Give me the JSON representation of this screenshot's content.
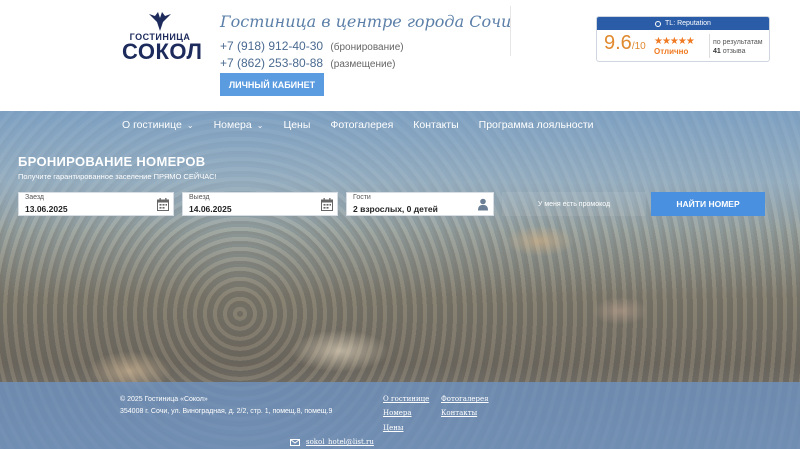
{
  "header": {
    "logo_small": "ГОСТИНИЦА",
    "logo_big": "СОКОЛ",
    "tagline": "Гостиница в центре города Сочи",
    "phones": [
      {
        "number": "+7 (918) 912-40-30",
        "note": "(бронирование)"
      },
      {
        "number": "+7 (862) 253-80-88",
        "note": "(размещение)"
      }
    ],
    "cabinet_label": "ЛИЧНЫЙ КАБИНЕТ"
  },
  "reputation": {
    "brand": "TL: Reputation",
    "score": "9.6",
    "scale": "/10",
    "stars": "★★★★★",
    "label": "Отлично",
    "based_on": "по результатам",
    "count": "41",
    "count_label": "отзыва"
  },
  "nav": {
    "items": [
      {
        "label": "О гостинице",
        "dropdown": true
      },
      {
        "label": "Номера",
        "dropdown": true
      },
      {
        "label": "Цены",
        "dropdown": false
      },
      {
        "label": "Фотогалерея",
        "dropdown": false
      },
      {
        "label": "Контакты",
        "dropdown": false
      },
      {
        "label": "Программа лояльности",
        "dropdown": false
      }
    ]
  },
  "booking": {
    "title": "БРОНИРОВАНИЕ НОМЕРОВ",
    "subtitle": "Получите гарантированное заселение ПРЯМО СЕЙЧАС!",
    "checkin_label": "Заезд",
    "checkin_value": "13.06.2025",
    "checkout_label": "Выезд",
    "checkout_value": "14.06.2025",
    "guests_label": "Гости",
    "guests_value": "2 взрослых, 0 детей",
    "promo_label": "У меня есть промокод",
    "search_label": "НАЙТИ НОМЕР"
  },
  "footer": {
    "copyright": "© 2025 Гостиница «Сокол»",
    "address": "354008 г. Сочи, ул. Виноградная, д. 2/2, стр. 1, помещ.8, помещ.9",
    "links": [
      "О гостинице",
      "Номера",
      "Цены",
      "Фотогалерея",
      "Контакты"
    ],
    "email": "sokol_hotel@list.ru"
  },
  "colors": {
    "brand_navy": "#1c2a5c",
    "accent_blue": "#4a90e0",
    "rating_orange": "#f07a22"
  }
}
